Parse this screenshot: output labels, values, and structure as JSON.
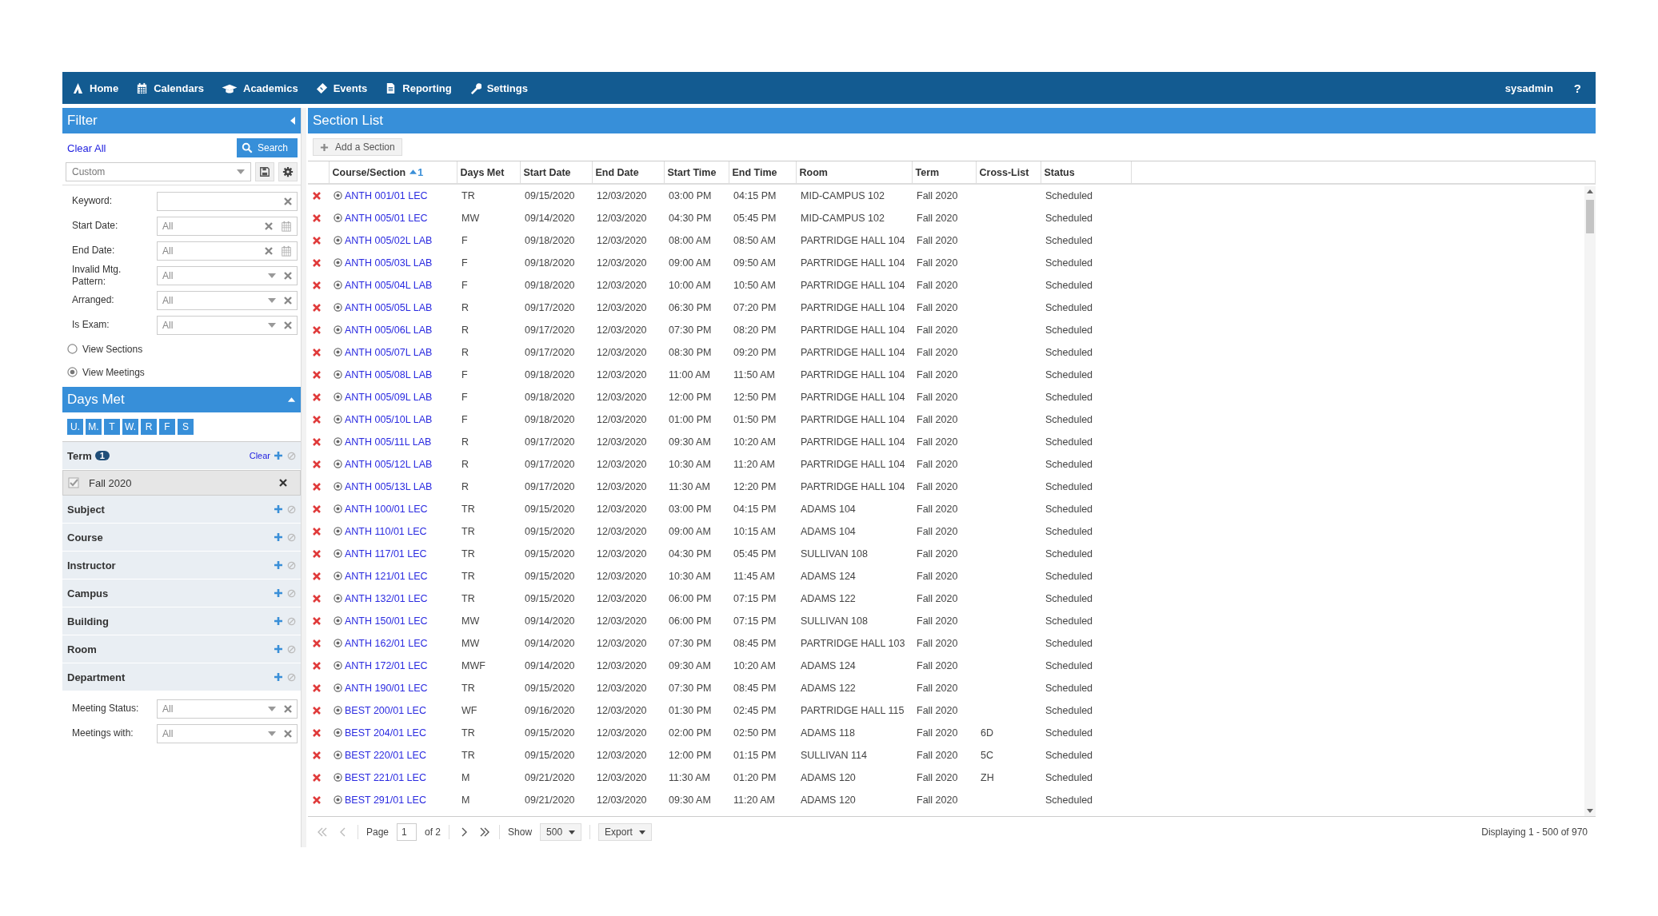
{
  "nav": {
    "items": [
      {
        "label": "Home"
      },
      {
        "label": "Calendars"
      },
      {
        "label": "Academics"
      },
      {
        "label": "Events"
      },
      {
        "label": "Reporting"
      },
      {
        "label": "Settings"
      }
    ],
    "user": "sysadmin",
    "help": "?"
  },
  "filter": {
    "title": "Filter",
    "clear_all": "Clear All",
    "search_button": "Search",
    "preset": "Custom",
    "fields": [
      {
        "label": "Keyword:",
        "kind": "text"
      },
      {
        "label": "Start Date:",
        "kind": "date",
        "value": "All"
      },
      {
        "label": "End Date:",
        "kind": "date",
        "value": "All"
      },
      {
        "label": "Invalid Mtg. Pattern:",
        "kind": "select",
        "value": "All"
      },
      {
        "label": "Arranged:",
        "kind": "select",
        "value": "All"
      },
      {
        "label": "Is Exam:",
        "kind": "select",
        "value": "All"
      }
    ],
    "view_options": [
      {
        "label": "View Sections",
        "selected": false
      },
      {
        "label": "View Meetings",
        "selected": true
      }
    ],
    "days_met": {
      "title": "Days Met",
      "expanded": true,
      "days": [
        "U.",
        "M.",
        "T",
        "W.",
        "R",
        "F",
        "S"
      ]
    },
    "facets": [
      {
        "name": "Term",
        "count": "1",
        "clear": "Clear",
        "children": [
          {
            "label": "Fall 2020",
            "checked": true
          }
        ]
      },
      {
        "name": "Subject"
      },
      {
        "name": "Course"
      },
      {
        "name": "Instructor"
      },
      {
        "name": "Campus"
      },
      {
        "name": "Building"
      },
      {
        "name": "Room"
      },
      {
        "name": "Department"
      }
    ],
    "bottom_fields": [
      {
        "label": "Meeting Status:",
        "kind": "select",
        "value": "All"
      },
      {
        "label": "Meetings with:",
        "kind": "select",
        "value": "All"
      }
    ]
  },
  "section_list": {
    "title": "Section List",
    "add_button": "Add a Section",
    "columns": [
      {
        "label": "Course/Section",
        "sort_rank": "1"
      },
      {
        "label": "Days Met"
      },
      {
        "label": "Start Date"
      },
      {
        "label": "End Date"
      },
      {
        "label": "Start Time"
      },
      {
        "label": "End Time"
      },
      {
        "label": "Room"
      },
      {
        "label": "Term"
      },
      {
        "label": "Cross-List"
      },
      {
        "label": "Status"
      }
    ],
    "rows": [
      {
        "course": "ANTH 001/01 LEC",
        "days": "TR",
        "start_date": "09/15/2020",
        "end_date": "12/03/2020",
        "start_time": "03:00 PM",
        "end_time": "04:15 PM",
        "room": "MID-CAMPUS 102",
        "term": "Fall 2020",
        "status": "Scheduled"
      },
      {
        "course": "ANTH 005/01 LEC",
        "days": "MW",
        "start_date": "09/14/2020",
        "end_date": "12/03/2020",
        "start_time": "04:30 PM",
        "end_time": "05:45 PM",
        "room": "MID-CAMPUS 102",
        "term": "Fall 2020",
        "status": "Scheduled"
      },
      {
        "course": "ANTH 005/02L LAB",
        "days": "F",
        "start_date": "09/18/2020",
        "end_date": "12/03/2020",
        "start_time": "08:00 AM",
        "end_time": "08:50 AM",
        "room": "PARTRIDGE HALL 104",
        "term": "Fall 2020",
        "status": "Scheduled"
      },
      {
        "course": "ANTH 005/03L LAB",
        "days": "F",
        "start_date": "09/18/2020",
        "end_date": "12/03/2020",
        "start_time": "09:00 AM",
        "end_time": "09:50 AM",
        "room": "PARTRIDGE HALL 104",
        "term": "Fall 2020",
        "status": "Scheduled"
      },
      {
        "course": "ANTH 005/04L LAB",
        "days": "F",
        "start_date": "09/18/2020",
        "end_date": "12/03/2020",
        "start_time": "10:00 AM",
        "end_time": "10:50 AM",
        "room": "PARTRIDGE HALL 104",
        "term": "Fall 2020",
        "status": "Scheduled"
      },
      {
        "course": "ANTH 005/05L LAB",
        "days": "R",
        "start_date": "09/17/2020",
        "end_date": "12/03/2020",
        "start_time": "06:30 PM",
        "end_time": "07:20 PM",
        "room": "PARTRIDGE HALL 104",
        "term": "Fall 2020",
        "status": "Scheduled"
      },
      {
        "course": "ANTH 005/06L LAB",
        "days": "R",
        "start_date": "09/17/2020",
        "end_date": "12/03/2020",
        "start_time": "07:30 PM",
        "end_time": "08:20 PM",
        "room": "PARTRIDGE HALL 104",
        "term": "Fall 2020",
        "status": "Scheduled"
      },
      {
        "course": "ANTH 005/07L LAB",
        "days": "R",
        "start_date": "09/17/2020",
        "end_date": "12/03/2020",
        "start_time": "08:30 PM",
        "end_time": "09:20 PM",
        "room": "PARTRIDGE HALL 104",
        "term": "Fall 2020",
        "status": "Scheduled"
      },
      {
        "course": "ANTH 005/08L LAB",
        "days": "F",
        "start_date": "09/18/2020",
        "end_date": "12/03/2020",
        "start_time": "11:00 AM",
        "end_time": "11:50 AM",
        "room": "PARTRIDGE HALL 104",
        "term": "Fall 2020",
        "status": "Scheduled"
      },
      {
        "course": "ANTH 005/09L LAB",
        "days": "F",
        "start_date": "09/18/2020",
        "end_date": "12/03/2020",
        "start_time": "12:00 PM",
        "end_time": "12:50 PM",
        "room": "PARTRIDGE HALL 104",
        "term": "Fall 2020",
        "status": "Scheduled"
      },
      {
        "course": "ANTH 005/10L LAB",
        "days": "F",
        "start_date": "09/18/2020",
        "end_date": "12/03/2020",
        "start_time": "01:00 PM",
        "end_time": "01:50 PM",
        "room": "PARTRIDGE HALL 104",
        "term": "Fall 2020",
        "status": "Scheduled"
      },
      {
        "course": "ANTH 005/11L LAB",
        "days": "R",
        "start_date": "09/17/2020",
        "end_date": "12/03/2020",
        "start_time": "09:30 AM",
        "end_time": "10:20 AM",
        "room": "PARTRIDGE HALL 104",
        "term": "Fall 2020",
        "status": "Scheduled"
      },
      {
        "course": "ANTH 005/12L LAB",
        "days": "R",
        "start_date": "09/17/2020",
        "end_date": "12/03/2020",
        "start_time": "10:30 AM",
        "end_time": "11:20 AM",
        "room": "PARTRIDGE HALL 104",
        "term": "Fall 2020",
        "status": "Scheduled"
      },
      {
        "course": "ANTH 005/13L LAB",
        "days": "R",
        "start_date": "09/17/2020",
        "end_date": "12/03/2020",
        "start_time": "11:30 AM",
        "end_time": "12:20 PM",
        "room": "PARTRIDGE HALL 104",
        "term": "Fall 2020",
        "status": "Scheduled"
      },
      {
        "course": "ANTH 100/01 LEC",
        "days": "TR",
        "start_date": "09/15/2020",
        "end_date": "12/03/2020",
        "start_time": "03:00 PM",
        "end_time": "04:15 PM",
        "room": "ADAMS 104",
        "term": "Fall 2020",
        "status": "Scheduled"
      },
      {
        "course": "ANTH 110/01 LEC",
        "days": "TR",
        "start_date": "09/15/2020",
        "end_date": "12/03/2020",
        "start_time": "09:00 AM",
        "end_time": "10:15 AM",
        "room": "ADAMS 104",
        "term": "Fall 2020",
        "status": "Scheduled"
      },
      {
        "course": "ANTH 117/01 LEC",
        "days": "TR",
        "start_date": "09/15/2020",
        "end_date": "12/03/2020",
        "start_time": "04:30 PM",
        "end_time": "05:45 PM",
        "room": "SULLIVAN 108",
        "term": "Fall 2020",
        "status": "Scheduled"
      },
      {
        "course": "ANTH 121/01 LEC",
        "days": "TR",
        "start_date": "09/15/2020",
        "end_date": "12/03/2020",
        "start_time": "10:30 AM",
        "end_time": "11:45 AM",
        "room": "ADAMS 124",
        "term": "Fall 2020",
        "status": "Scheduled"
      },
      {
        "course": "ANTH 132/01 LEC",
        "days": "TR",
        "start_date": "09/15/2020",
        "end_date": "12/03/2020",
        "start_time": "06:00 PM",
        "end_time": "07:15 PM",
        "room": "ADAMS 122",
        "term": "Fall 2020",
        "status": "Scheduled"
      },
      {
        "course": "ANTH 150/01 LEC",
        "days": "MW",
        "start_date": "09/14/2020",
        "end_date": "12/03/2020",
        "start_time": "06:00 PM",
        "end_time": "07:15 PM",
        "room": "SULLIVAN 108",
        "term": "Fall 2020",
        "status": "Scheduled"
      },
      {
        "course": "ANTH 162/01 LEC",
        "days": "MW",
        "start_date": "09/14/2020",
        "end_date": "12/03/2020",
        "start_time": "07:30 PM",
        "end_time": "08:45 PM",
        "room": "PARTRIDGE HALL 103",
        "term": "Fall 2020",
        "status": "Scheduled"
      },
      {
        "course": "ANTH 172/01 LEC",
        "days": "MWF",
        "start_date": "09/14/2020",
        "end_date": "12/03/2020",
        "start_time": "09:30 AM",
        "end_time": "10:20 AM",
        "room": "ADAMS 124",
        "term": "Fall 2020",
        "status": "Scheduled"
      },
      {
        "course": "ANTH 190/01 LEC",
        "days": "TR",
        "start_date": "09/15/2020",
        "end_date": "12/03/2020",
        "start_time": "07:30 PM",
        "end_time": "08:45 PM",
        "room": "ADAMS 122",
        "term": "Fall 2020",
        "status": "Scheduled"
      },
      {
        "course": "BEST 200/01 LEC",
        "days": "WF",
        "start_date": "09/16/2020",
        "end_date": "12/03/2020",
        "start_time": "01:30 PM",
        "end_time": "02:45 PM",
        "room": "PARTRIDGE HALL 115",
        "term": "Fall 2020",
        "status": "Scheduled"
      },
      {
        "course": "BEST 204/01 LEC",
        "days": "TR",
        "start_date": "09/15/2020",
        "end_date": "12/03/2020",
        "start_time": "02:00 PM",
        "end_time": "02:50 PM",
        "room": "ADAMS 118",
        "term": "Fall 2020",
        "cross_list": "6D",
        "status": "Scheduled"
      },
      {
        "course": "BEST 220/01 LEC",
        "days": "TR",
        "start_date": "09/15/2020",
        "end_date": "12/03/2020",
        "start_time": "12:00 PM",
        "end_time": "01:15 PM",
        "room": "SULLIVAN 114",
        "term": "Fall 2020",
        "cross_list": "5C",
        "status": "Scheduled"
      },
      {
        "course": "BEST 221/01 LEC",
        "days": "M",
        "start_date": "09/21/2020",
        "end_date": "12/03/2020",
        "start_time": "11:30 AM",
        "end_time": "01:20 PM",
        "room": "ADAMS 120",
        "term": "Fall 2020",
        "cross_list": "ZH",
        "status": "Scheduled"
      },
      {
        "course": "BEST 291/01 LEC",
        "days": "M",
        "start_date": "09/21/2020",
        "end_date": "12/03/2020",
        "start_time": "09:30 AM",
        "end_time": "11:20 AM",
        "room": "ADAMS 120",
        "term": "Fall 2020",
        "status": "Scheduled"
      }
    ],
    "pager": {
      "page_label": "Page",
      "page": "1",
      "of": "of 2",
      "show_label": "Show",
      "page_size": "500",
      "export": "Export",
      "displaying": "Displaying 1 - 500 of 970"
    }
  }
}
